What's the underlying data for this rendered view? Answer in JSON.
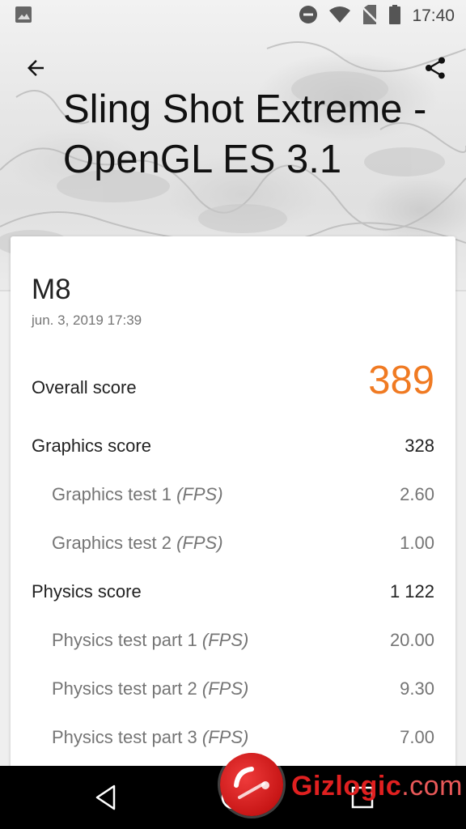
{
  "status_bar": {
    "time": "17:40",
    "icons": [
      "image-icon",
      "do-not-disturb-icon",
      "wifi-icon",
      "no-sim-icon",
      "battery-icon"
    ]
  },
  "app_bar": {
    "back_icon": "arrow-back-icon",
    "share_icon": "share-icon"
  },
  "title": "Sling Shot Extreme - OpenGL ES 3.1",
  "result": {
    "device": "M8",
    "date": "jun. 3, 2019 17:39",
    "overall": {
      "label": "Overall score",
      "value": "389"
    },
    "graphics": {
      "label": "Graphics score",
      "value": "328",
      "tests": [
        {
          "label": "Graphics test 1",
          "unit": "(FPS)",
          "value": "2.60"
        },
        {
          "label": "Graphics test 2",
          "unit": "(FPS)",
          "value": "1.00"
        }
      ]
    },
    "physics": {
      "label": "Physics score",
      "value": "1 122",
      "tests": [
        {
          "label": "Physics test part 1",
          "unit": "(FPS)",
          "value": "20.00"
        },
        {
          "label": "Physics test part 2",
          "unit": "(FPS)",
          "value": "9.30"
        },
        {
          "label": "Physics test part 3",
          "unit": "(FPS)",
          "value": "7.00"
        }
      ]
    }
  },
  "colors": {
    "accent": "#f07a22",
    "watermark": "#e02020"
  },
  "watermark": {
    "brand": "Gizlogic",
    "tld": ".com"
  },
  "nav_bar": {
    "icons": [
      "nav-back-icon",
      "nav-home-icon",
      "nav-recents-icon"
    ]
  }
}
